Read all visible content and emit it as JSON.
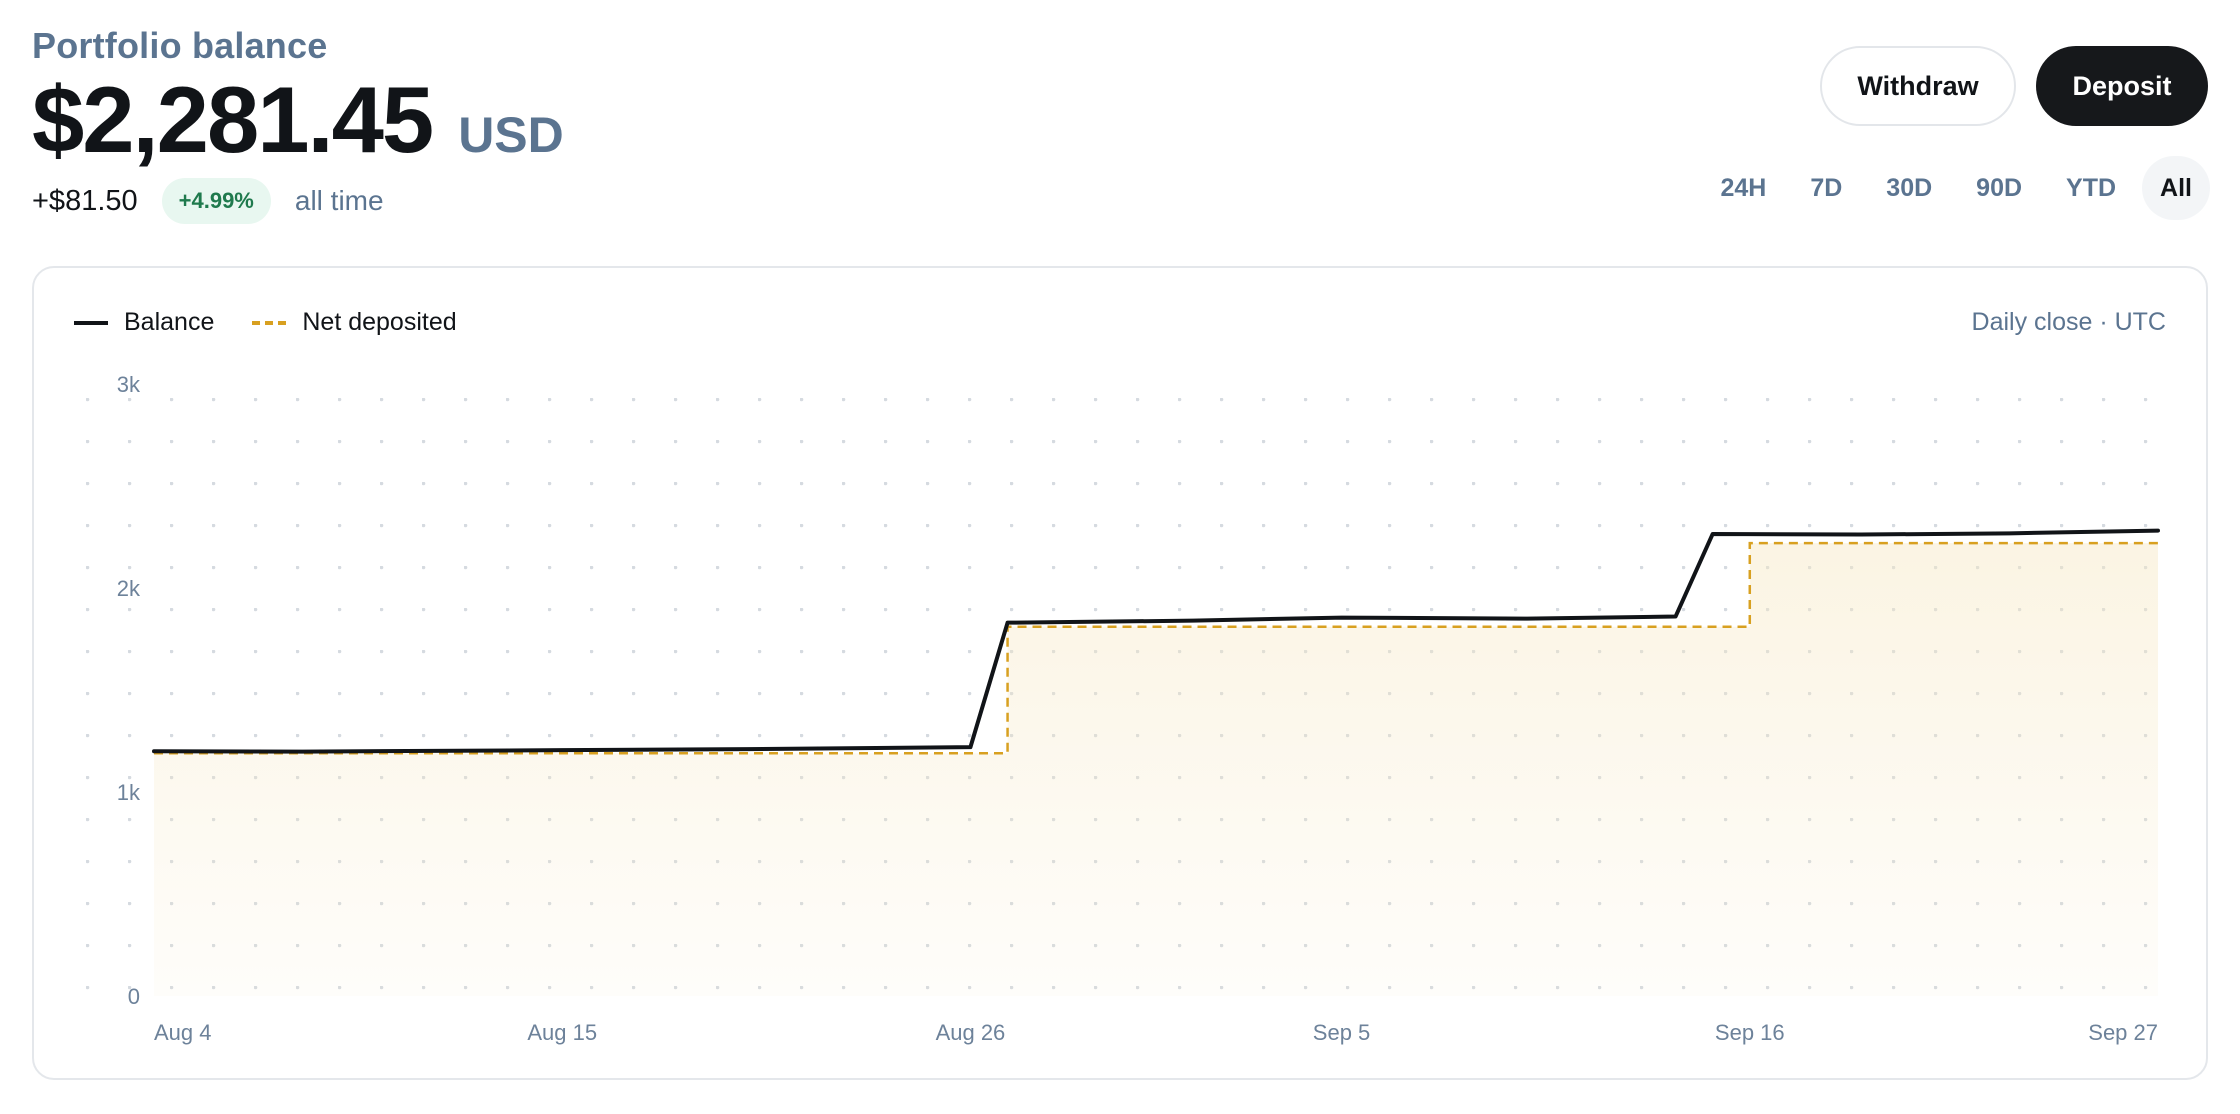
{
  "header": {
    "title": "Portfolio balance",
    "amount": "$2,281.45",
    "currency": "USD",
    "change": "+$81.50",
    "change_pct": "+4.99%",
    "period_label": "all time"
  },
  "actions": {
    "withdraw_label": "Withdraw",
    "deposit_label": "Deposit"
  },
  "ranges": [
    {
      "label": "24H",
      "active": false
    },
    {
      "label": "7D",
      "active": false
    },
    {
      "label": "30D",
      "active": false
    },
    {
      "label": "90D",
      "active": false
    },
    {
      "label": "YTD",
      "active": false
    },
    {
      "label": "All",
      "active": true
    }
  ],
  "chart_note": "Daily close · UTC",
  "colors": {
    "balance": "#111418",
    "net_deposited": "#d8a020",
    "area_fill": "#f6e7c1"
  },
  "chart_data": {
    "type": "line",
    "ylim": [
      0,
      3000
    ],
    "yticks": [
      0,
      1000,
      2000,
      3000
    ],
    "ytick_labels": [
      "0",
      "1k",
      "2k",
      "3k"
    ],
    "xlim": [
      "2024-08-04",
      "2024-09-27"
    ],
    "xticks": [
      "2024-08-04",
      "2024-08-15",
      "2024-08-26",
      "2024-09-05",
      "2024-09-16",
      "2024-09-27"
    ],
    "xtick_labels": [
      "Aug 4",
      "Aug 15",
      "Aug 26",
      "Sep 5",
      "Sep 16",
      "Sep 27"
    ],
    "grid": true,
    "legend_position": "top-left",
    "series": [
      {
        "name": "Balance",
        "style": "solid",
        "x": [
          "2024-08-04",
          "2024-08-08",
          "2024-08-15",
          "2024-08-20",
          "2024-08-26",
          "2024-08-27",
          "2024-09-01",
          "2024-09-05",
          "2024-09-10",
          "2024-09-14",
          "2024-09-15",
          "2024-09-19",
          "2024-09-23",
          "2024-09-27"
        ],
        "y": [
          1200,
          1198,
          1205,
          1210,
          1220,
          1830,
          1840,
          1855,
          1850,
          1860,
          2265,
          2262,
          2268,
          2281.45
        ]
      },
      {
        "name": "Net deposited",
        "style": "dashed",
        "step": true,
        "x": [
          "2024-08-04",
          "2024-08-27",
          "2024-09-16",
          "2024-09-27"
        ],
        "y": [
          1190,
          1810,
          2220,
          2220
        ]
      }
    ]
  }
}
